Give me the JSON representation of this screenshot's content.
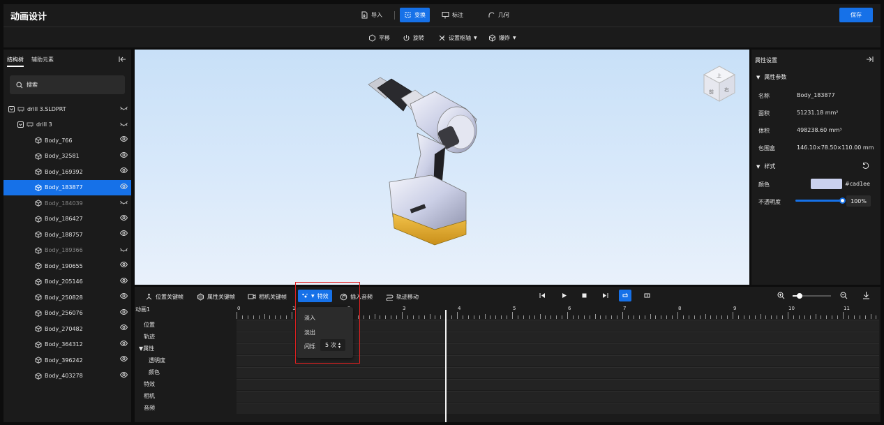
{
  "app": {
    "title": "动画设计",
    "save_label": "保存"
  },
  "modes": [
    {
      "label": "导入",
      "icon": "import-icon",
      "active": false
    },
    {
      "label": "变换",
      "icon": "transform-icon",
      "active": true
    },
    {
      "label": "标注",
      "icon": "annotate-icon",
      "active": false
    },
    {
      "label": "几何",
      "icon": "geometry-icon",
      "active": false
    }
  ],
  "tools": [
    {
      "label": "平移",
      "icon": "move-icon",
      "dropdown": false
    },
    {
      "label": "旋转",
      "icon": "rotate-icon",
      "dropdown": false
    },
    {
      "label": "设置枢轴",
      "icon": "pivot-icon",
      "dropdown": true
    },
    {
      "label": "爆炸",
      "icon": "explode-icon",
      "dropdown": true
    }
  ],
  "left_panel": {
    "tabs": [
      "结构树",
      "辅助元素"
    ],
    "active_tab": 0,
    "search_placeholder": "搜索",
    "tree": [
      {
        "label": "drill 3.SLDPRT",
        "level": 0,
        "type": "assembly",
        "visible": false
      },
      {
        "label": "drill 3",
        "level": 1,
        "type": "assembly",
        "visible": false
      },
      {
        "label": "Body_766",
        "level": 2,
        "type": "body",
        "visible": true
      },
      {
        "label": "Body_32581",
        "level": 2,
        "type": "body",
        "visible": true
      },
      {
        "label": "Body_169392",
        "level": 2,
        "type": "body",
        "visible": true
      },
      {
        "label": "Body_183877",
        "level": 2,
        "type": "body",
        "visible": true,
        "selected": true
      },
      {
        "label": "Body_184039",
        "level": 2,
        "type": "body",
        "visible": false,
        "dim": true
      },
      {
        "label": "Body_186427",
        "level": 2,
        "type": "body",
        "visible": true
      },
      {
        "label": "Body_188757",
        "level": 2,
        "type": "body",
        "visible": true
      },
      {
        "label": "Body_189366",
        "level": 2,
        "type": "body",
        "visible": false,
        "dim": true
      },
      {
        "label": "Body_190655",
        "level": 2,
        "type": "body",
        "visible": true
      },
      {
        "label": "Body_205146",
        "level": 2,
        "type": "body",
        "visible": true
      },
      {
        "label": "Body_250828",
        "level": 2,
        "type": "body",
        "visible": true
      },
      {
        "label": "Body_256076",
        "level": 2,
        "type": "body",
        "visible": true
      },
      {
        "label": "Body_270482",
        "level": 2,
        "type": "body",
        "visible": true
      },
      {
        "label": "Body_364312",
        "level": 2,
        "type": "body",
        "visible": true
      },
      {
        "label": "Body_396242",
        "level": 2,
        "type": "body",
        "visible": true
      },
      {
        "label": "Body_403278",
        "level": 2,
        "type": "body",
        "visible": true
      }
    ]
  },
  "view_cube": {
    "faces": [
      "上",
      "前",
      "右"
    ]
  },
  "right_panel": {
    "title": "属性设置",
    "section_params": "属性参数",
    "props": [
      {
        "label": "名称",
        "value": "Body_183877"
      },
      {
        "label": "面积",
        "value": "51231.18 mm²"
      },
      {
        "label": "体积",
        "value": "498238.60 mm³"
      },
      {
        "label": "包围盒",
        "value": "146.10×78.50×110.00 mm"
      }
    ],
    "section_style": "样式",
    "color_label": "颜色",
    "color_value": "#cad1ee",
    "opacity_label": "不透明度",
    "opacity_value": "100%",
    "opacity_level": 1.0
  },
  "timeline_toolbar": {
    "buttons": [
      {
        "label": "位置关键帧",
        "icon": "position-keyframe-icon"
      },
      {
        "label": "属性关键帧",
        "icon": "property-keyframe-icon"
      },
      {
        "label": "相机关键帧",
        "icon": "camera-keyframe-icon"
      },
      {
        "label": "特效",
        "icon": "effects-icon",
        "active": true
      },
      {
        "label": "插入音频",
        "icon": "audio-icon"
      },
      {
        "label": "轨迹移动",
        "icon": "path-move-icon"
      }
    ],
    "loop_active": true
  },
  "timeline": {
    "name": "动画1",
    "ruler": [
      "0",
      "1",
      "2",
      "3",
      "4",
      "5",
      "6",
      "7",
      "8",
      "9",
      "10",
      "11"
    ],
    "playhead": 3.8,
    "tracks": [
      "位置",
      "轨迹",
      "▼属性",
      "透明度",
      "颜色",
      "特效",
      "相机",
      "音频"
    ]
  },
  "effects_menu": {
    "items": [
      "淡入",
      "淡出"
    ],
    "blink_label": "闪烁",
    "blink_count": "5",
    "blink_unit": "次"
  },
  "colors": {
    "accent": "#1671e8",
    "panel": "#1b1b1b",
    "highlight": "#e02020"
  }
}
